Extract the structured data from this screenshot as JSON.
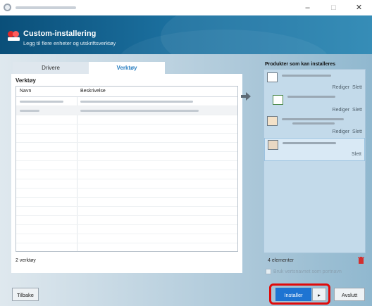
{
  "window": {
    "minimize": "–",
    "maximize": "□",
    "close": "✕"
  },
  "header": {
    "title": "Custom-installering",
    "subtitle": "Legg til flere enheter og utskriftsverktøy"
  },
  "tabs": [
    {
      "label": "Drivere"
    },
    {
      "label": "Verktøy"
    }
  ],
  "tools": {
    "section_label": "Verktøy",
    "columns": [
      "Navn",
      "Beskrivelse"
    ],
    "count": "2 verktøy"
  },
  "products": {
    "title": "Produkter som kan installeres",
    "items": [
      {
        "edit": "Rediger",
        "delete": "Slett"
      },
      {
        "edit": "Rediger",
        "delete": "Slett"
      },
      {
        "edit": "Rediger",
        "delete": "Slett"
      },
      {
        "delete": "Slett"
      }
    ],
    "count": "4 elementer",
    "hostname_checkbox": "Bruk vertsnavnet som portnavn"
  },
  "footer": {
    "back": "Tilbake",
    "install": "Installer",
    "exit": "Avslutt"
  },
  "colors": {
    "accent": "#1e74d2",
    "header": "#0a4f79",
    "highlight": "#e00b0b"
  }
}
